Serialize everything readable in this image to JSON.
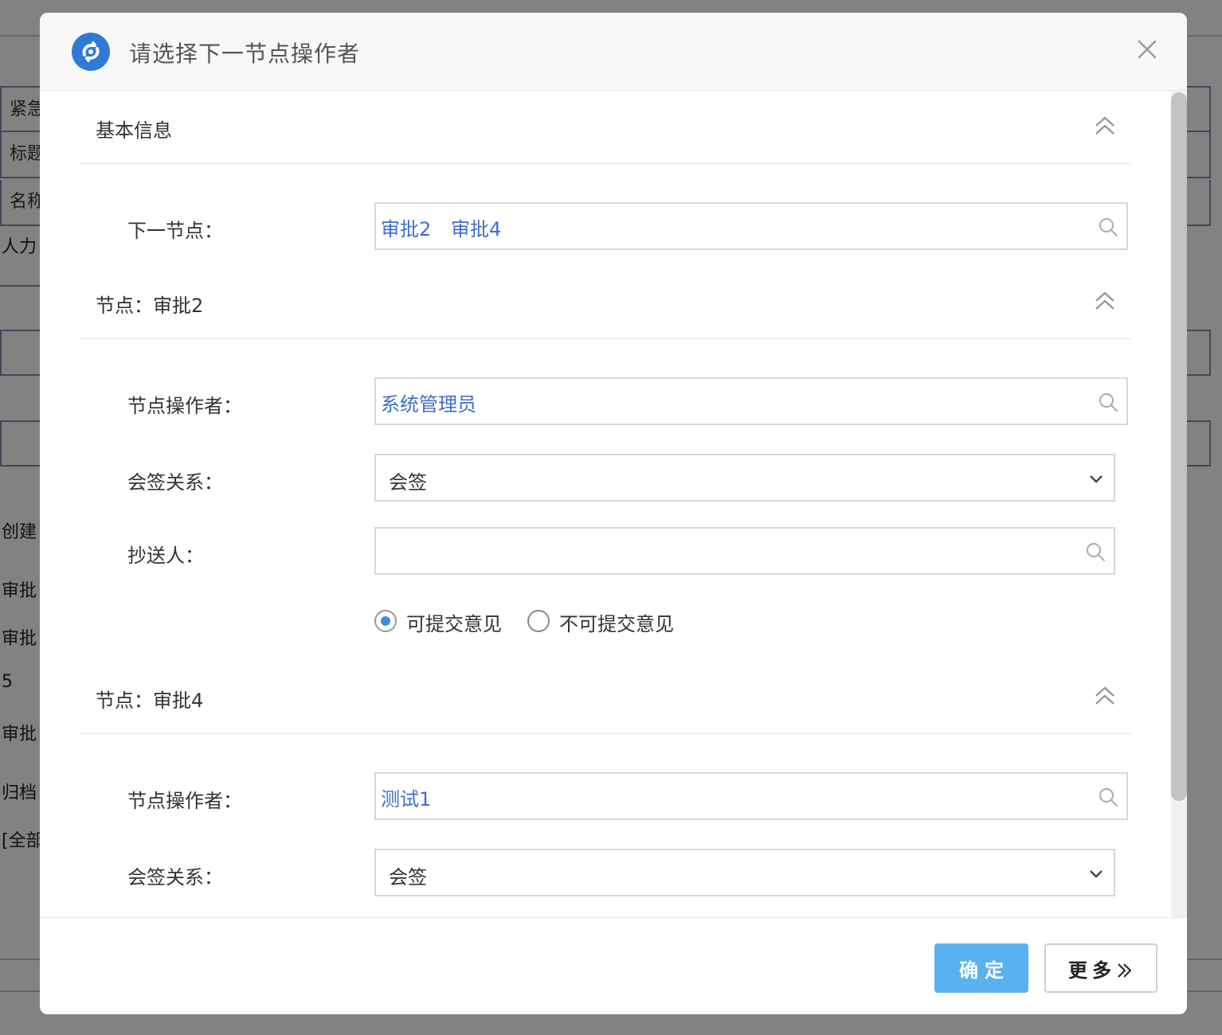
{
  "background": {
    "rows": [
      "紧急",
      "标题",
      "名称"
    ],
    "texts": [
      "人力",
      "创建",
      "审批",
      "审批",
      "5",
      "审批",
      "归档",
      "[全部"
    ]
  },
  "dialog": {
    "title": "请选择下一节点操作者",
    "sections": {
      "basic": {
        "title": "基本信息"
      },
      "node1": {
        "title": "节点：审批2"
      },
      "node2": {
        "title": "节点：审批4"
      }
    },
    "next_node": {
      "label": "下一节点：",
      "tags": [
        "审批2",
        "审批4"
      ]
    },
    "node1": {
      "operator_label": "节点操作者：",
      "operator": "系统管理员",
      "relation_label": "会签关系：",
      "relation": "会签",
      "cc_label": "抄送人：",
      "cc_value": "",
      "radio_options": [
        {
          "label": "可提交意见",
          "checked": true
        },
        {
          "label": "不可提交意见",
          "checked": false
        }
      ]
    },
    "node2": {
      "operator_label": "节点操作者：",
      "operator": "测试1",
      "relation_label": "会签关系：",
      "relation": "会签"
    },
    "footer": {
      "confirm": "确定",
      "more": "更多"
    }
  },
  "colors": {
    "accent": "#5ab1ef",
    "link": "#3d6ec9",
    "logo": "#2f7ad6"
  }
}
